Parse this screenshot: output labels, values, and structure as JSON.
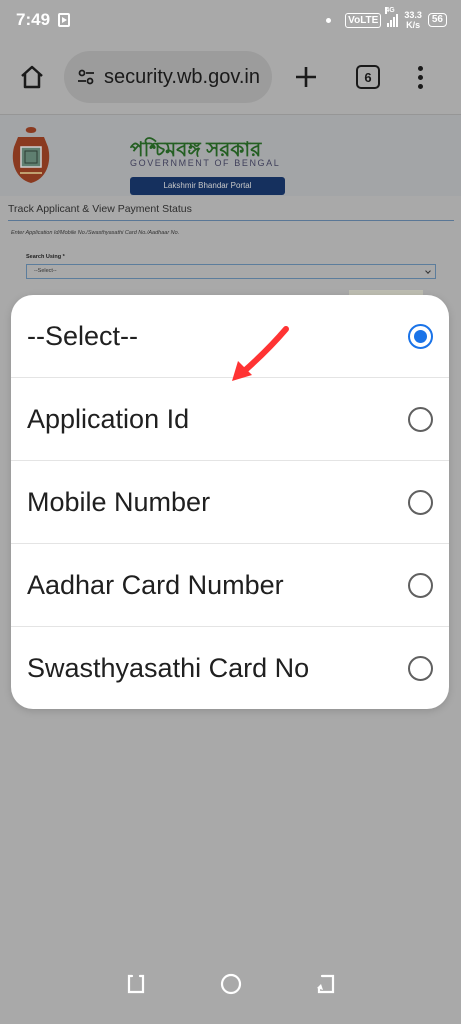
{
  "status_bar": {
    "time": "7:49",
    "volte": "VoLTE",
    "network_gen": "4G",
    "speed_value": "33.3",
    "speed_unit": "K/s",
    "battery": "56"
  },
  "browser": {
    "url": "security.wb.gov.in",
    "tab_count": "6"
  },
  "page": {
    "banner_title": "পশ্চিমবঙ্গ সরকার",
    "banner_subtitle": "GOVERNMENT OF BENGAL",
    "portal_label": "Lakshmir Bhandar Portal",
    "heading": "Track Applicant & View Payment Status",
    "enter_note": "Enter Application Id/Mobile No./Swasthyasathi Card No./Aadhaar No.",
    "search_label": "Search Using *",
    "select_value": "--Select--"
  },
  "dropdown": {
    "options": [
      {
        "label": "--Select--",
        "selected": true
      },
      {
        "label": "Application Id",
        "selected": false
      },
      {
        "label": "Mobile Number",
        "selected": false
      },
      {
        "label": "Aadhar Card Number",
        "selected": false
      },
      {
        "label": "Swasthyasathi Card No",
        "selected": false
      }
    ]
  },
  "colors": {
    "accent": "#1a73e8",
    "annotation": "#ff3333",
    "overlay": "#a9a9a9"
  }
}
